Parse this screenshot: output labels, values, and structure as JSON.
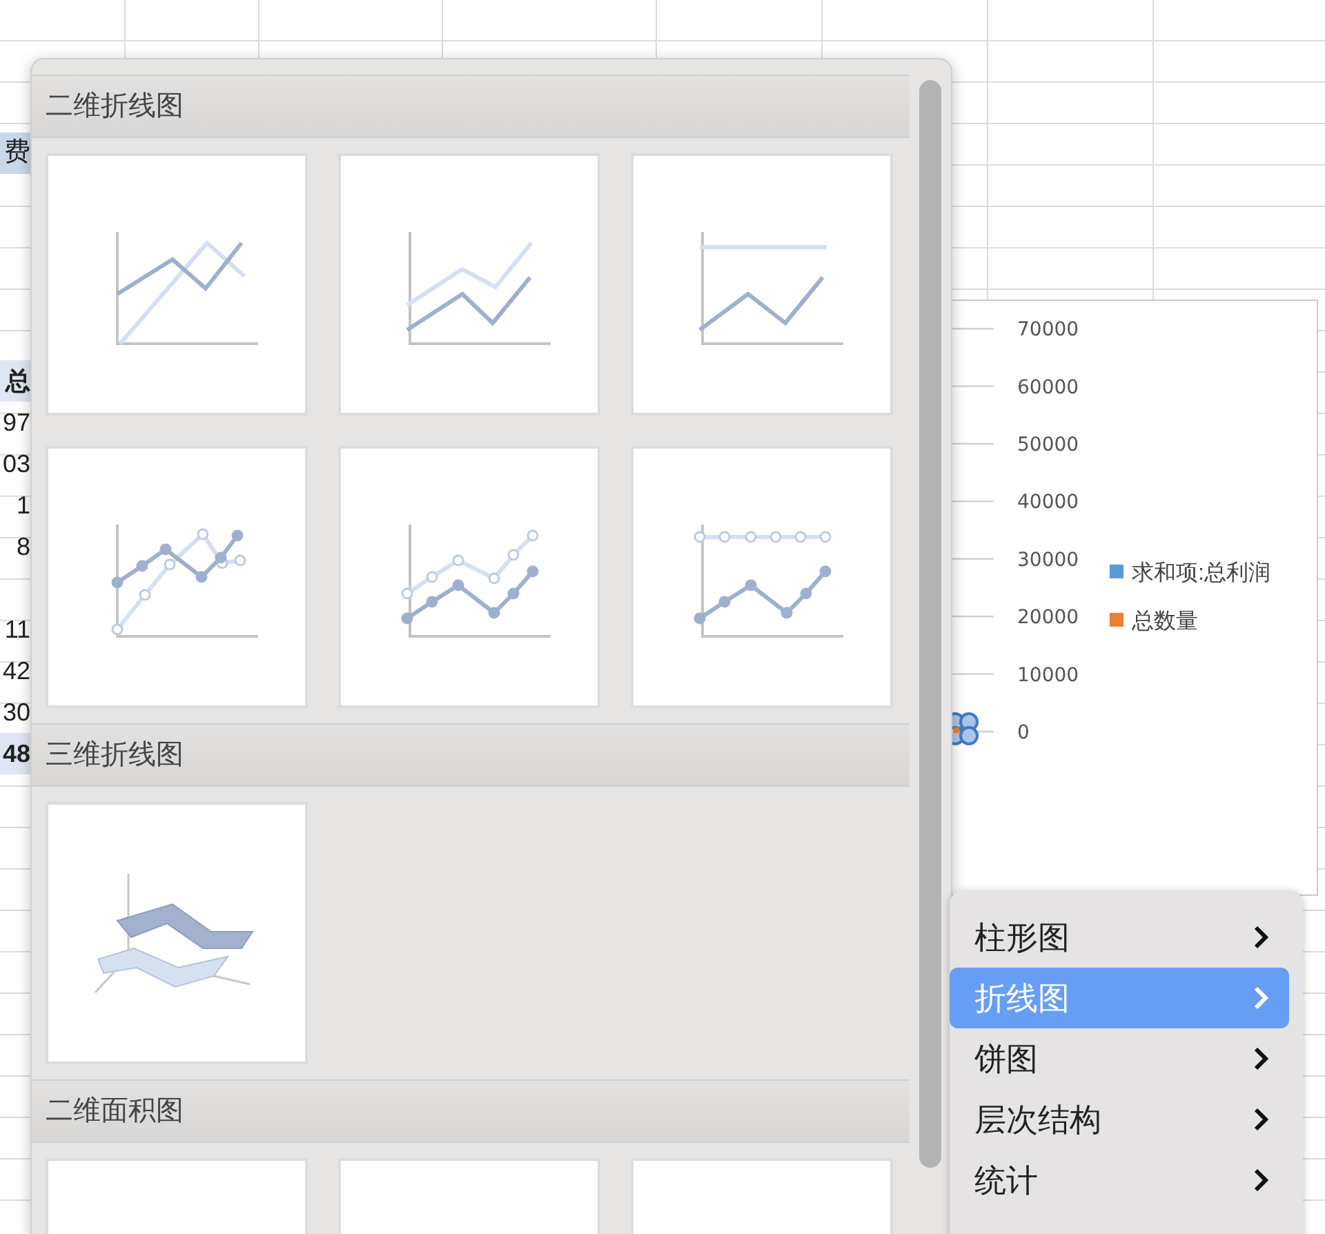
{
  "sheet": {
    "cells": [
      {
        "text": "费",
        "kind": "header"
      },
      {
        "text": "总",
        "kind": "label"
      },
      {
        "text": "97",
        "kind": "value"
      },
      {
        "text": "03",
        "kind": "value"
      },
      {
        "text": "1",
        "kind": "value"
      },
      {
        "text": "8",
        "kind": "value"
      },
      {
        "text": "11",
        "kind": "value"
      },
      {
        "text": "42",
        "kind": "value"
      },
      {
        "text": "30",
        "kind": "value"
      },
      {
        "text": "48",
        "kind": "total"
      }
    ]
  },
  "gallery": {
    "sections": [
      {
        "title": "二维折线图",
        "tiles": [
          {
            "kind": "line"
          },
          {
            "kind": "stacked"
          },
          {
            "kind": "percent"
          },
          {
            "kind": "markers"
          },
          {
            "kind": "stackedmarkers"
          },
          {
            "kind": "percentmarkers"
          }
        ]
      },
      {
        "title": "三维折线图",
        "tiles": [
          {
            "kind": "perspective"
          }
        ]
      },
      {
        "title": "二维面积图",
        "tiles": [
          {
            "kind": "area"
          },
          {
            "kind": "area"
          },
          {
            "kind": "area"
          }
        ]
      }
    ]
  },
  "chart": {
    "axis_labels": [
      "70000",
      "60000",
      "50000",
      "40000",
      "30000",
      "20000",
      "10000",
      "0"
    ],
    "legend": [
      {
        "label": "求和项:总利润",
        "color": "#5b9bd5"
      },
      {
        "label": "总数量",
        "color": "#ed7d31"
      }
    ]
  },
  "menu": {
    "items": [
      {
        "label": "柱形图",
        "selected": false
      },
      {
        "label": "折线图",
        "selected": true
      },
      {
        "label": "饼图",
        "selected": false
      },
      {
        "label": "层次结构",
        "selected": false
      },
      {
        "label": "统计",
        "selected": false
      }
    ]
  }
}
